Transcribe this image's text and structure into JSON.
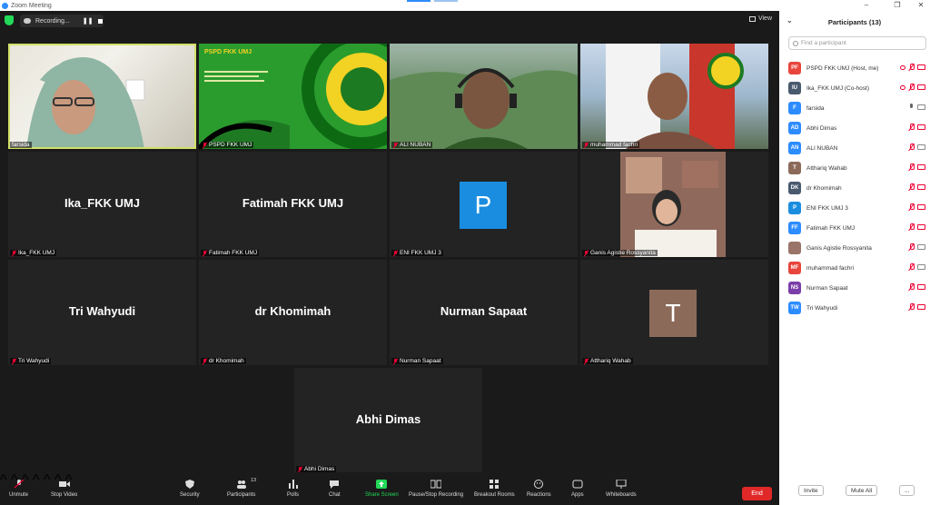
{
  "window": {
    "title": "Zoom Meeting"
  },
  "topbar": {
    "recording_label": "Recording...",
    "view_label": "View"
  },
  "tiles": [
    {
      "name": "farsida",
      "big": ""
    },
    {
      "name": "PSPD FKK UMJ",
      "big": ""
    },
    {
      "name": "ALI NUBAN",
      "big": ""
    },
    {
      "name": "muhammad fachri",
      "big": ""
    },
    {
      "name": "Ika_FKK UMJ",
      "big": "Ika_FKK UMJ"
    },
    {
      "name": "Fatimah FKK UMJ",
      "big": "Fatimah FKK UMJ"
    },
    {
      "name": "ENI FKK UMJ 3",
      "big": "P"
    },
    {
      "name": "Ganis Agistie Rossyanita",
      "big": ""
    },
    {
      "name": "Tri Wahyudi",
      "big": "Tri Wahyudi"
    },
    {
      "name": "dr Khomimah",
      "big": "dr Khomimah"
    },
    {
      "name": "Nurman Sapaat",
      "big": "Nurman Sapaat"
    },
    {
      "name": "Atthariq Wahab",
      "big": "T"
    },
    {
      "name": "Abhi Dimas",
      "big": "Abhi Dimas"
    }
  ],
  "slide": {
    "line1": "PSPD FKK UMJ"
  },
  "toolbar": {
    "unmute": "Unmute",
    "stop_video": "Stop Video",
    "security": "Security",
    "participants": "Participants",
    "participants_count": "13",
    "polls": "Polls",
    "chat": "Chat",
    "share_screen": "Share Screen",
    "record": "Pause/Stop Recording",
    "breakout": "Breakout Rooms",
    "reactions": "Reactions",
    "apps": "Apps",
    "whiteboards": "Whiteboards",
    "end": "End"
  },
  "panel": {
    "title": "Participants (13)",
    "search_placeholder": "Find a participant",
    "invite": "Invite",
    "mute_all": "Mute All",
    "more": "..."
  },
  "participants": [
    {
      "initials": "PF",
      "name": "PSPD FKK UMJ (Host, me)",
      "color": "#e8453c"
    },
    {
      "initials": "IU",
      "name": "Ika_FKK UMJ (Co-host)",
      "color": "#4a5a6e"
    },
    {
      "initials": "F",
      "name": "farsida",
      "color": "#2d8cff"
    },
    {
      "initials": "AD",
      "name": "Abhi Dimas",
      "color": "#2d8cff"
    },
    {
      "initials": "AN",
      "name": "ALI NUBAN",
      "color": "#2d8cff"
    },
    {
      "initials": "T",
      "name": "Atthariq Wahab",
      "color": "#8c6a5a"
    },
    {
      "initials": "DK",
      "name": "dr Khomimah",
      "color": "#4a5a6e"
    },
    {
      "initials": "P",
      "name": "ENI FKK UMJ 3",
      "color": "#1a8de0"
    },
    {
      "initials": "FF",
      "name": "Fatimah FKK UMJ",
      "color": "#2d8cff"
    },
    {
      "initials": "",
      "name": "Ganis Agistie Rossyanita",
      "color": "#9a7468"
    },
    {
      "initials": "MF",
      "name": "muhammad fachri",
      "color": "#e8453c"
    },
    {
      "initials": "NS",
      "name": "Nurman Sapaat",
      "color": "#7a3ea8"
    },
    {
      "initials": "TW",
      "name": "Tri Wahyudi",
      "color": "#2d8cff"
    }
  ]
}
